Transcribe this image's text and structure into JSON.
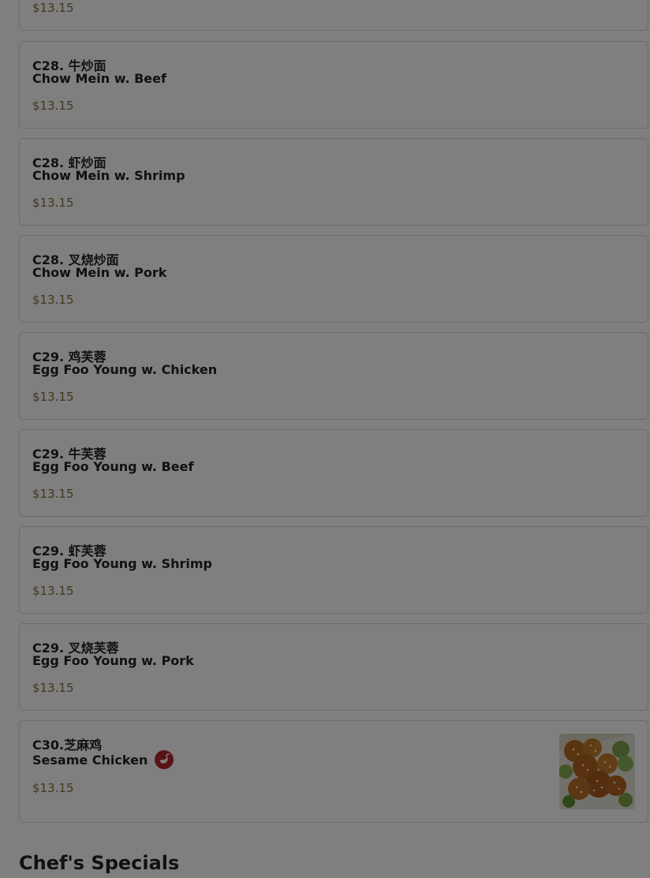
{
  "menu": {
    "partial_price": "$13.15",
    "items": [
      {
        "code": "C28. 牛炒面",
        "name": "Chow Mein w. Beef",
        "price": "$13.15"
      },
      {
        "code": "C28. 虾炒面",
        "name": "Chow Mein w. Shrimp",
        "price": "$13.15"
      },
      {
        "code": "C28. 叉烧炒面",
        "name": "Chow Mein w. Pork",
        "price": "$13.15"
      },
      {
        "code": "C29. 鸡芙蓉",
        "name": "Egg Foo Young w. Chicken",
        "price": "$13.15"
      },
      {
        "code": "C29. 牛芙蓉",
        "name": "Egg Foo Young w. Beef",
        "price": "$13.15"
      },
      {
        "code": "C29. 虾芙蓉",
        "name": "Egg Foo Young w. Shrimp",
        "price": "$13.15"
      },
      {
        "code": "C29. 叉烧芙蓉",
        "name": "Egg Foo Young w. Pork",
        "price": "$13.15"
      },
      {
        "code": "C30.芝麻鸡",
        "name": "Sesame Chicken",
        "price": "$13.15",
        "icon": "spicy-pepper-icon"
      }
    ]
  },
  "section": {
    "title": "Chef's Specials"
  },
  "colors": {
    "price": "#8a6d3b",
    "spicy_badge": "#b3262e",
    "overlay": "rgba(0,0,0,0.5)"
  }
}
